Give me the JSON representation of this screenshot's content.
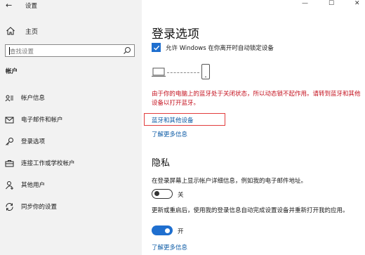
{
  "window": {
    "back_glyph": "←",
    "title": "设置",
    "controls": {
      "minimize": "—",
      "maximize": "☐",
      "close": "✕"
    }
  },
  "sidebar": {
    "home_label": "主页",
    "search_placeholder": "查找设置",
    "section_title": "帐户",
    "items": [
      {
        "label": "帐户信息",
        "icon": "account-info-icon"
      },
      {
        "label": "电子邮件和帐户",
        "icon": "mail-icon"
      },
      {
        "label": "登录选项",
        "icon": "key-icon"
      },
      {
        "label": "连接工作或学校帐户",
        "icon": "briefcase-icon"
      },
      {
        "label": "其他用户",
        "icon": "add-user-icon"
      },
      {
        "label": "同步你的设置",
        "icon": "sync-icon"
      }
    ]
  },
  "main": {
    "page_title": "登录选项",
    "dynamic_lock_checkbox_label": "允许 Windows 在你离开时自动锁定设备",
    "dynamic_lock_checked": true,
    "bluetooth_warning": "由于你的电脑上的蓝牙处于关闭状态，所以动态锁不起作用。请转到蓝牙和其他设备以打开蓝牙。",
    "bluetooth_link": "蓝牙和其他设备",
    "learn_more_1": "了解更多信息",
    "privacy": {
      "title": "隐私",
      "show_account_details_text": "在登录屏幕上显示帐户详细信息，例如我的电子邮件地址。",
      "toggle1_state": "关",
      "auto_finish_setup_text": "更新或重启后，使用我的登录信息自动完成设置设备并重新打开我的应用。",
      "toggle2_state": "开",
      "learn_more_2": "了解更多信息"
    }
  },
  "colors": {
    "accent": "#1f6fcf",
    "link": "#0b5aa5",
    "warning": "#c4111e",
    "highlight": "#e23d3d",
    "sidebar_bg": "#f2f2f2"
  }
}
